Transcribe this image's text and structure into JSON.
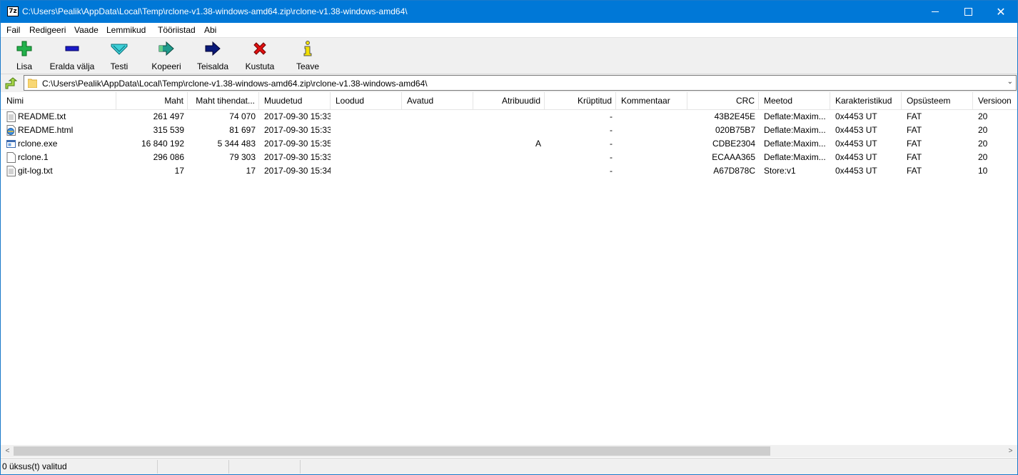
{
  "titlebar": {
    "app_icon_text": "7z",
    "title": "C:\\Users\\Pealik\\AppData\\Local\\Temp\\rclone-v1.38-windows-amd64.zip\\rclone-v1.38-windows-amd64\\",
    "minimize_icon": "minimize-icon",
    "maximize_icon": "maximize-icon",
    "close_icon": "close-icon",
    "close_glyph": "✕"
  },
  "menu": {
    "items": [
      {
        "label": "Fail"
      },
      {
        "label": "Redigeeri"
      },
      {
        "label": "Vaade"
      },
      {
        "label": "Lemmikud"
      },
      {
        "label": "Tööriistad"
      },
      {
        "label": "Abi"
      }
    ]
  },
  "toolbar": {
    "buttons": [
      {
        "label": "Lisa",
        "icon": "add-icon"
      },
      {
        "label": "Eralda välja",
        "icon": "extract-icon"
      },
      {
        "label": "Testi",
        "icon": "test-icon"
      },
      {
        "label": "Kopeeri",
        "icon": "copy-icon"
      },
      {
        "label": "Teisalda",
        "icon": "move-icon"
      },
      {
        "label": "Kustuta",
        "icon": "delete-icon"
      },
      {
        "label": "Teave",
        "icon": "info-icon"
      }
    ]
  },
  "address": {
    "path": "C:\\Users\\Pealik\\AppData\\Local\\Temp\\rclone-v1.38-windows-amd64.zip\\rclone-v1.38-windows-amd64\\",
    "chevron": "⌄"
  },
  "columns": [
    "Nimi",
    "Maht",
    "Maht tihendat...",
    "Muudetud",
    "Loodud",
    "Avatud",
    "Atribuudid",
    "Krüptitud",
    "Kommentaar",
    "CRC",
    "Meetod",
    "Karakteristikud",
    "Opsüsteem",
    "Versioon"
  ],
  "files": [
    {
      "icon": "text-file-icon",
      "name": "README.txt",
      "size": "261 497",
      "packed": "74 070",
      "modified": "2017-09-30 15:33",
      "created": "",
      "accessed": "",
      "attributes": "",
      "encrypted": "-",
      "comment": "",
      "crc": "43B2E45E",
      "method": "Deflate:Maxim...",
      "characteristics": "0x4453 UT",
      "os": "FAT",
      "version": "20"
    },
    {
      "icon": "html-file-icon",
      "name": "README.html",
      "size": "315 539",
      "packed": "81 697",
      "modified": "2017-09-30 15:33",
      "created": "",
      "accessed": "",
      "attributes": "",
      "encrypted": "-",
      "comment": "",
      "crc": "020B75B7",
      "method": "Deflate:Maxim...",
      "characteristics": "0x4453 UT",
      "os": "FAT",
      "version": "20"
    },
    {
      "icon": "exe-file-icon",
      "name": "rclone.exe",
      "size": "16 840 192",
      "packed": "5 344 483",
      "modified": "2017-09-30 15:35",
      "created": "",
      "accessed": "",
      "attributes": "A",
      "encrypted": "-",
      "comment": "",
      "crc": "CDBE2304",
      "method": "Deflate:Maxim...",
      "characteristics": "0x4453 UT",
      "os": "FAT",
      "version": "20"
    },
    {
      "icon": "blank-file-icon",
      "name": "rclone.1",
      "size": "296 086",
      "packed": "79 303",
      "modified": "2017-09-30 15:33",
      "created": "",
      "accessed": "",
      "attributes": "",
      "encrypted": "-",
      "comment": "",
      "crc": "ECAAA365",
      "method": "Deflate:Maxim...",
      "characteristics": "0x4453 UT",
      "os": "FAT",
      "version": "20"
    },
    {
      "icon": "text-file-icon",
      "name": "git-log.txt",
      "size": "17",
      "packed": "17",
      "modified": "2017-09-30 15:34",
      "created": "",
      "accessed": "",
      "attributes": "",
      "encrypted": "-",
      "comment": "",
      "crc": "A67D878C",
      "method": "Store:v1",
      "characteristics": "0x4453 UT",
      "os": "FAT",
      "version": "10"
    }
  ],
  "scrollbar": {
    "left_arrow": "<",
    "right_arrow": ">"
  },
  "status": {
    "selection": "0 üksus(t) valitud",
    "part2": "",
    "part3": "",
    "part4": ""
  }
}
